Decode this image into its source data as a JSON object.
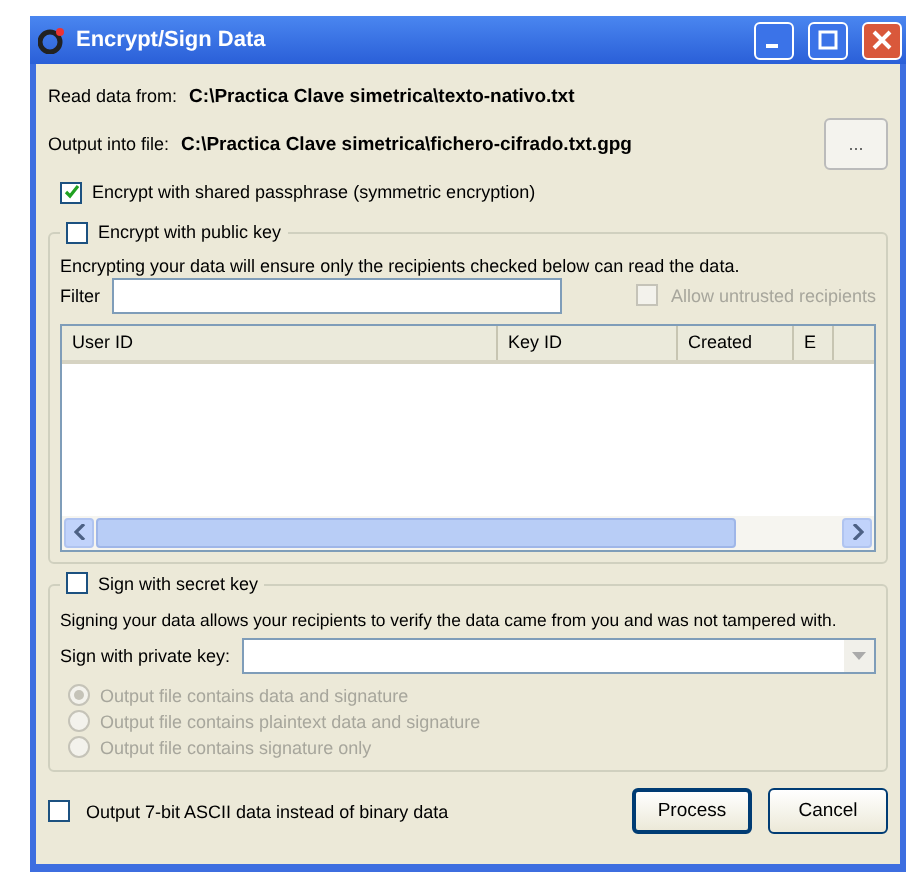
{
  "window": {
    "title": "Encrypt/Sign Data"
  },
  "read_from": {
    "label": "Read data from:",
    "value": "C:\\Practica Clave simetrica\\texto-nativo.txt"
  },
  "output_into": {
    "label": "Output into file:",
    "value": "C:\\Practica Clave simetrica\\fichero-cifrado.txt.gpg",
    "browse_button": "..."
  },
  "symmetric": {
    "label": "Encrypt with shared passphrase (symmetric encryption)",
    "checked": true
  },
  "public_key_group": {
    "label": "Encrypt with public key",
    "checked": false,
    "description": "Encrypting your data will ensure only the recipients checked below can read the data.",
    "filter": {
      "label": "Filter"
    },
    "allow_untrusted": {
      "label": "Allow untrusted recipients",
      "checked": false,
      "disabled": true
    },
    "table": {
      "columns": [
        "User ID",
        "Key ID",
        "Created",
        "E"
      ]
    }
  },
  "sign_group": {
    "label": "Sign with secret key",
    "checked": false,
    "description": "Signing your data allows your recipients to verify the data came from you and was not tampered with.",
    "private_key": {
      "label": "Sign with private key:"
    },
    "options": [
      {
        "label": "Output file contains data and signature",
        "selected": true,
        "disabled": true
      },
      {
        "label": "Output file contains plaintext data and signature",
        "selected": false,
        "disabled": true
      },
      {
        "label": "Output file contains signature only",
        "selected": false,
        "disabled": true
      }
    ]
  },
  "ascii_armor": {
    "label": "Output 7-bit ASCII data instead of binary data",
    "checked": false
  },
  "buttons": [
    "Process",
    "Cancel"
  ]
}
